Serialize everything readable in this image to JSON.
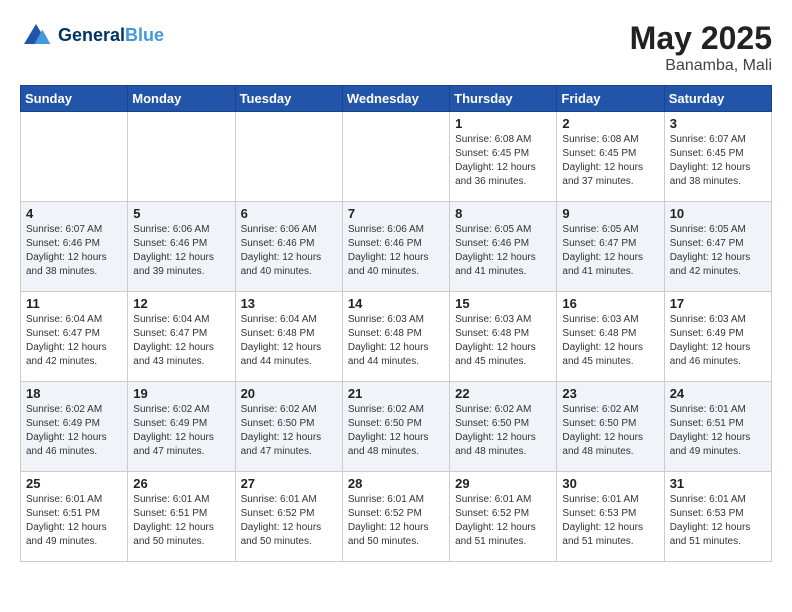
{
  "header": {
    "logo_line1": "General",
    "logo_line2": "Blue",
    "month_year": "May 2025",
    "location": "Banamba, Mali"
  },
  "weekdays": [
    "Sunday",
    "Monday",
    "Tuesday",
    "Wednesday",
    "Thursday",
    "Friday",
    "Saturday"
  ],
  "weeks": [
    [
      {
        "day": "",
        "info": ""
      },
      {
        "day": "",
        "info": ""
      },
      {
        "day": "",
        "info": ""
      },
      {
        "day": "",
        "info": ""
      },
      {
        "day": "1",
        "info": "Sunrise: 6:08 AM\nSunset: 6:45 PM\nDaylight: 12 hours\nand 36 minutes."
      },
      {
        "day": "2",
        "info": "Sunrise: 6:08 AM\nSunset: 6:45 PM\nDaylight: 12 hours\nand 37 minutes."
      },
      {
        "day": "3",
        "info": "Sunrise: 6:07 AM\nSunset: 6:45 PM\nDaylight: 12 hours\nand 38 minutes."
      }
    ],
    [
      {
        "day": "4",
        "info": "Sunrise: 6:07 AM\nSunset: 6:46 PM\nDaylight: 12 hours\nand 38 minutes."
      },
      {
        "day": "5",
        "info": "Sunrise: 6:06 AM\nSunset: 6:46 PM\nDaylight: 12 hours\nand 39 minutes."
      },
      {
        "day": "6",
        "info": "Sunrise: 6:06 AM\nSunset: 6:46 PM\nDaylight: 12 hours\nand 40 minutes."
      },
      {
        "day": "7",
        "info": "Sunrise: 6:06 AM\nSunset: 6:46 PM\nDaylight: 12 hours\nand 40 minutes."
      },
      {
        "day": "8",
        "info": "Sunrise: 6:05 AM\nSunset: 6:46 PM\nDaylight: 12 hours\nand 41 minutes."
      },
      {
        "day": "9",
        "info": "Sunrise: 6:05 AM\nSunset: 6:47 PM\nDaylight: 12 hours\nand 41 minutes."
      },
      {
        "day": "10",
        "info": "Sunrise: 6:05 AM\nSunset: 6:47 PM\nDaylight: 12 hours\nand 42 minutes."
      }
    ],
    [
      {
        "day": "11",
        "info": "Sunrise: 6:04 AM\nSunset: 6:47 PM\nDaylight: 12 hours\nand 42 minutes."
      },
      {
        "day": "12",
        "info": "Sunrise: 6:04 AM\nSunset: 6:47 PM\nDaylight: 12 hours\nand 43 minutes."
      },
      {
        "day": "13",
        "info": "Sunrise: 6:04 AM\nSunset: 6:48 PM\nDaylight: 12 hours\nand 44 minutes."
      },
      {
        "day": "14",
        "info": "Sunrise: 6:03 AM\nSunset: 6:48 PM\nDaylight: 12 hours\nand 44 minutes."
      },
      {
        "day": "15",
        "info": "Sunrise: 6:03 AM\nSunset: 6:48 PM\nDaylight: 12 hours\nand 45 minutes."
      },
      {
        "day": "16",
        "info": "Sunrise: 6:03 AM\nSunset: 6:48 PM\nDaylight: 12 hours\nand 45 minutes."
      },
      {
        "day": "17",
        "info": "Sunrise: 6:03 AM\nSunset: 6:49 PM\nDaylight: 12 hours\nand 46 minutes."
      }
    ],
    [
      {
        "day": "18",
        "info": "Sunrise: 6:02 AM\nSunset: 6:49 PM\nDaylight: 12 hours\nand 46 minutes."
      },
      {
        "day": "19",
        "info": "Sunrise: 6:02 AM\nSunset: 6:49 PM\nDaylight: 12 hours\nand 47 minutes."
      },
      {
        "day": "20",
        "info": "Sunrise: 6:02 AM\nSunset: 6:50 PM\nDaylight: 12 hours\nand 47 minutes."
      },
      {
        "day": "21",
        "info": "Sunrise: 6:02 AM\nSunset: 6:50 PM\nDaylight: 12 hours\nand 48 minutes."
      },
      {
        "day": "22",
        "info": "Sunrise: 6:02 AM\nSunset: 6:50 PM\nDaylight: 12 hours\nand 48 minutes."
      },
      {
        "day": "23",
        "info": "Sunrise: 6:02 AM\nSunset: 6:50 PM\nDaylight: 12 hours\nand 48 minutes."
      },
      {
        "day": "24",
        "info": "Sunrise: 6:01 AM\nSunset: 6:51 PM\nDaylight: 12 hours\nand 49 minutes."
      }
    ],
    [
      {
        "day": "25",
        "info": "Sunrise: 6:01 AM\nSunset: 6:51 PM\nDaylight: 12 hours\nand 49 minutes."
      },
      {
        "day": "26",
        "info": "Sunrise: 6:01 AM\nSunset: 6:51 PM\nDaylight: 12 hours\nand 50 minutes."
      },
      {
        "day": "27",
        "info": "Sunrise: 6:01 AM\nSunset: 6:52 PM\nDaylight: 12 hours\nand 50 minutes."
      },
      {
        "day": "28",
        "info": "Sunrise: 6:01 AM\nSunset: 6:52 PM\nDaylight: 12 hours\nand 50 minutes."
      },
      {
        "day": "29",
        "info": "Sunrise: 6:01 AM\nSunset: 6:52 PM\nDaylight: 12 hours\nand 51 minutes."
      },
      {
        "day": "30",
        "info": "Sunrise: 6:01 AM\nSunset: 6:53 PM\nDaylight: 12 hours\nand 51 minutes."
      },
      {
        "day": "31",
        "info": "Sunrise: 6:01 AM\nSunset: 6:53 PM\nDaylight: 12 hours\nand 51 minutes."
      }
    ]
  ]
}
